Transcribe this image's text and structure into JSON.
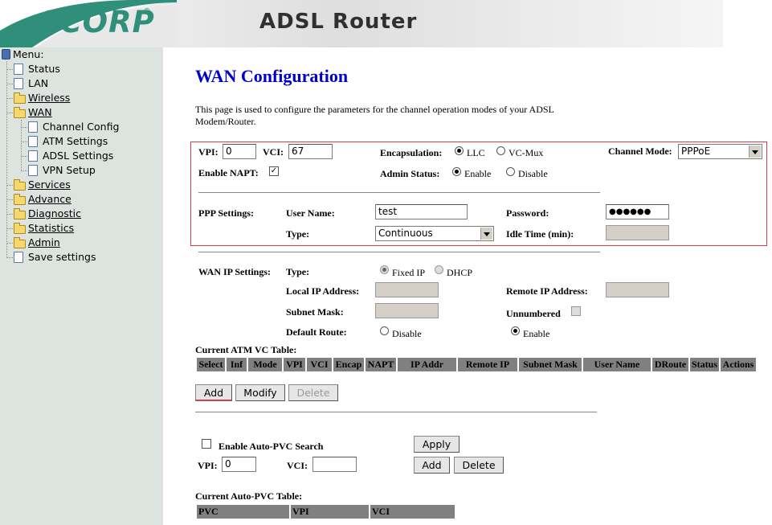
{
  "header": {
    "logo_text": "ACORP",
    "logo_reg": "®",
    "title": "ADSL Router"
  },
  "sidebar": {
    "menu_label": "Menu:",
    "items": [
      {
        "label": "Status"
      },
      {
        "label": "LAN"
      },
      {
        "label": "Wireless"
      },
      {
        "label": "WAN"
      },
      {
        "label": "Channel Config"
      },
      {
        "label": "ATM Settings"
      },
      {
        "label": "ADSL Settings"
      },
      {
        "label": "VPN Setup"
      },
      {
        "label": "Services"
      },
      {
        "label": "Advance"
      },
      {
        "label": "Diagnostic"
      },
      {
        "label": "Statistics"
      },
      {
        "label": "Admin"
      },
      {
        "label": "Save settings"
      }
    ]
  },
  "page": {
    "title": "WAN Configuration",
    "description": "This page is used to configure the parameters for the channel operation modes of your ADSL Modem/Router."
  },
  "channel": {
    "vpi_label": "VPI:",
    "vpi_value": "0",
    "vci_label": "VCI:",
    "vci_value": "67",
    "encap_label": "Encapsulation:",
    "encap_llc": "LLC",
    "encap_vcmux": "VC-Mux",
    "mode_label": "Channel Mode:",
    "mode_value": "PPPoE",
    "napt_label": "Enable NAPT:",
    "admin_label": "Admin Status:",
    "admin_enable": "Enable",
    "admin_disable": "Disable"
  },
  "ppp": {
    "section_label": "PPP Settings:",
    "username_label": "User Name:",
    "username_value": "test",
    "password_label": "Password:",
    "password_value": "●●●●●●",
    "type_label": "Type:",
    "type_value": "Continuous",
    "idle_label": "Idle Time (min):"
  },
  "wanip": {
    "section_label": "WAN IP Settings:",
    "type_label": "Type:",
    "fixed_ip": "Fixed IP",
    "dhcp": "DHCP",
    "local_ip_label": "Local IP Address:",
    "remote_ip_label": "Remote IP Address:",
    "subnet_label": "Subnet Mask:",
    "unnumbered_label": "Unnumbered",
    "default_route_label": "Default Route:",
    "disable": "Disable",
    "enable": "Enable"
  },
  "atm_table": {
    "title": "Current ATM VC Table:",
    "columns": [
      "Select",
      "Inf",
      "Mode",
      "VPI",
      "VCI",
      "Encap",
      "NAPT",
      "IP Addr",
      "Remote IP",
      "Subnet Mask",
      "User Name",
      "DRoute",
      "Status",
      "Actions"
    ]
  },
  "buttons": {
    "add": "Add",
    "modify": "Modify",
    "delete": "Delete",
    "apply": "Apply"
  },
  "autopvc": {
    "enable_label": "Enable Auto-PVC Search",
    "vpi_label": "VPI:",
    "vpi_value": "0",
    "vci_label": "VCI:",
    "vci_value": "",
    "table_title": "Current Auto-PVC Table:",
    "columns": [
      "PVC",
      "VPI",
      "VCI"
    ]
  },
  "colors": {
    "title_blue": "#0000cc",
    "sidebar_bg": "#dde3df",
    "box_red": "#d04050",
    "table_head": "#808080",
    "logo_green": "#2f8f7a"
  }
}
